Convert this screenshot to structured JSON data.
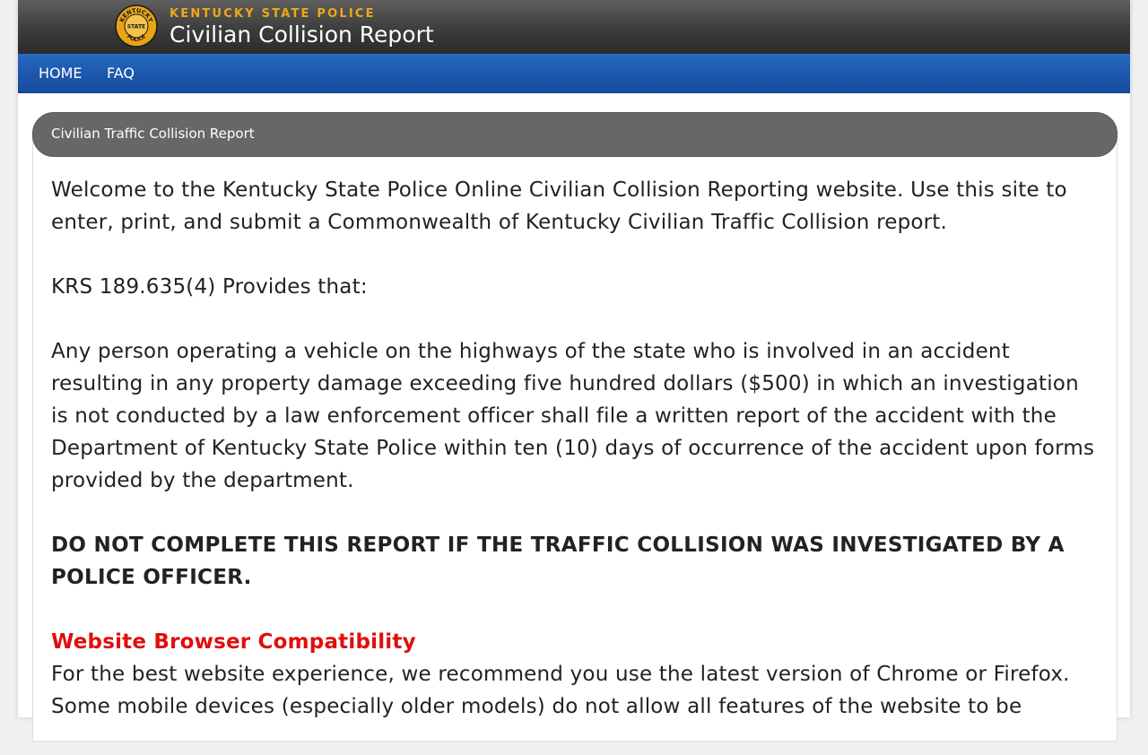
{
  "header": {
    "agency": "KENTUCKY STATE POLICE",
    "title": "Civilian Collision Report",
    "seal": {
      "icon": "kentucky-state-police-seal",
      "ring_text": "KENTUCKY",
      "center_text": "STATE",
      "bottom_text": "POLICE",
      "colors": {
        "gold": "#e8a317",
        "dark": "#1a1a1a"
      }
    }
  },
  "nav": {
    "items": [
      {
        "label": "HOME"
      },
      {
        "label": "FAQ"
      }
    ]
  },
  "panel": {
    "title": "Civilian Traffic Collision Report",
    "intro": "Welcome to the Kentucky State Police Online Civilian Collision Reporting website. Use this site to enter, print, and submit a Commonwealth of Kentucky Civilian Traffic Collision report.",
    "statute_ref": "KRS 189.635(4) Provides that:",
    "statute_text": "Any person operating a vehicle on the highways of the state who is involved in an accident resulting in any property damage exceeding five hundred dollars ($500) in which an investigation is not conducted by a law enforcement officer shall file a written report of the accident with the Department of Kentucky State Police within ten (10) days of occurrence of the accident upon forms provided by the department.",
    "warning": "DO NOT COMPLETE THIS REPORT IF THE TRAFFIC COLLISION WAS INVESTIGATED BY A POLICE OFFICER.",
    "compat_heading": "Website Browser Compatibility",
    "compat_text": "For the best website experience, we recommend you use the latest version of Chrome or Firefox. Some mobile devices (especially older models) do not allow all features of the website to be"
  },
  "colors": {
    "header_bg": "#3c3c3c",
    "agency_gold": "#f0a818",
    "nav_blue": "#1c55aa",
    "panel_heading": "#676767",
    "compat_red": "#e00e0e"
  }
}
